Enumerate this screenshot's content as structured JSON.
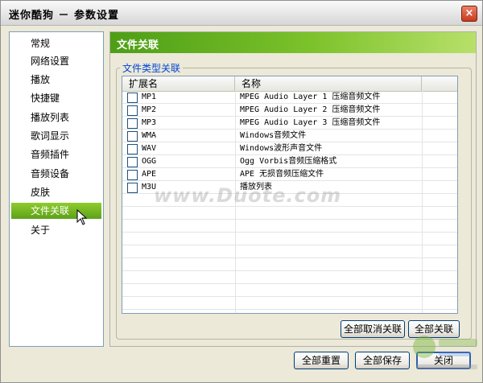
{
  "window": {
    "title": "迷你酷狗 － 参数设置",
    "close_glyph": "×"
  },
  "sidebar": {
    "items": [
      {
        "label": "常规"
      },
      {
        "label": "网络设置"
      },
      {
        "label": "播放"
      },
      {
        "label": "快捷键"
      },
      {
        "label": "播放列表"
      },
      {
        "label": "歌词显示"
      },
      {
        "label": "音频插件"
      },
      {
        "label": "音频设备"
      },
      {
        "label": "皮肤"
      },
      {
        "label": "文件关联",
        "selected": true
      },
      {
        "label": "关于"
      }
    ]
  },
  "panel": {
    "title": "文件关联",
    "group_label": "文件类型关联",
    "columns": {
      "ext": "扩展名",
      "name": "名称"
    },
    "rows": [
      {
        "ext": "MP1",
        "name": "MPEG Audio Layer 1 压缩音频文件",
        "checked": false
      },
      {
        "ext": "MP2",
        "name": "MPEG Audio Layer 2 压缩音频文件",
        "checked": false
      },
      {
        "ext": "MP3",
        "name": "MPEG Audio Layer 3 压缩音频文件",
        "checked": false
      },
      {
        "ext": "WMA",
        "name": "Windows音频文件",
        "checked": false
      },
      {
        "ext": "WAV",
        "name": "Windows波形声音文件",
        "checked": false
      },
      {
        "ext": "OGG",
        "name": "Ogg Vorbis音频压缩格式",
        "checked": false
      },
      {
        "ext": "APE",
        "name": "APE 无损音频压缩文件",
        "checked": false
      },
      {
        "ext": "M3U",
        "name": "播放列表",
        "checked": false
      }
    ],
    "buttons": {
      "unassoc_all": "全部取消关联",
      "assoc_all": "全部关联"
    }
  },
  "footer": {
    "reset_all": "全部重置",
    "save_all": "全部保存",
    "close": "关闭"
  },
  "watermark": {
    "text": "www.Duote.com"
  },
  "colors": {
    "accent_green": "#6cb523",
    "header_gradient_start": "#4d9e16",
    "close_red": "#c83b1c",
    "group_label_blue": "#0046d5"
  }
}
